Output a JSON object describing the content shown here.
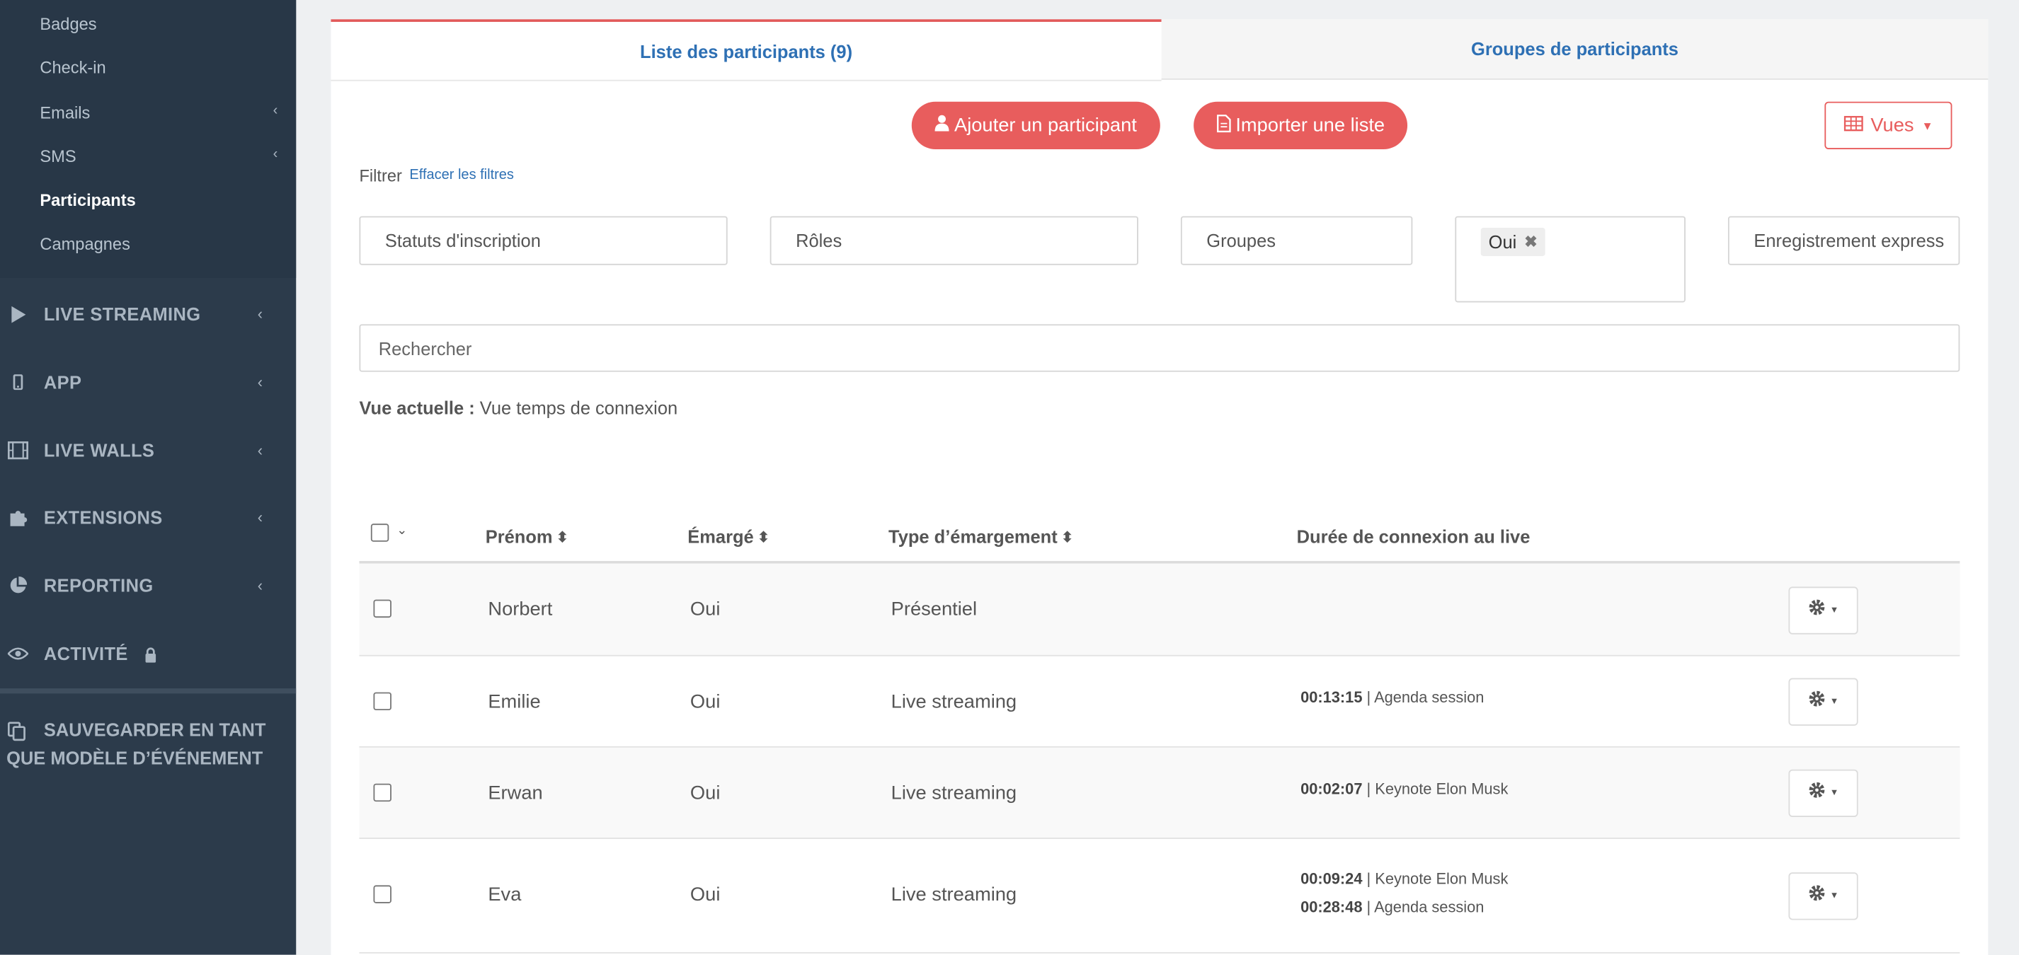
{
  "sidebar": {
    "sub_items": [
      {
        "label": "Badges",
        "chevron": false,
        "active": false
      },
      {
        "label": "Check-in",
        "chevron": false,
        "active": false
      },
      {
        "label": "Emails",
        "chevron": true,
        "active": false
      },
      {
        "label": "SMS",
        "chevron": true,
        "active": false
      },
      {
        "label": "Participants",
        "chevron": false,
        "active": true
      },
      {
        "label": "Campagnes",
        "chevron": false,
        "active": false
      }
    ],
    "nav": [
      {
        "label": "LIVE STREAMING",
        "icon": "play-icon"
      },
      {
        "label": "APP",
        "icon": "mobile-icon"
      },
      {
        "label": "LIVE WALLS",
        "icon": "film-icon"
      },
      {
        "label": "EXTENSIONS",
        "icon": "puzzle-icon"
      },
      {
        "label": "REPORTING",
        "icon": "pie-chart-icon"
      },
      {
        "label": "ACTIVITÉ",
        "icon": "eye-icon",
        "locked": true
      }
    ],
    "save_model_line1": "SAUVEGARDER EN TANT",
    "save_model_line2": "QUE MODÈLE D’ÉVÉNEMENT"
  },
  "tabs": {
    "participants": "Liste des participants (9)",
    "groups": "Groupes de participants"
  },
  "actions": {
    "add": "Ajouter un participant",
    "import": "Importer une liste",
    "views": "Vues"
  },
  "filters": {
    "label": "Filtrer",
    "clear": "Effacer les filtres",
    "status": "Statuts d'inscription",
    "roles": "Rôles",
    "groups": "Groupes",
    "tag": "Oui",
    "express": "Enregistrement express"
  },
  "search": {
    "placeholder": "Rechercher"
  },
  "current_view": {
    "label": "Vue actuelle :",
    "value": "Vue temps de connexion"
  },
  "table": {
    "headers": {
      "first_name": "Prénom",
      "signed": "Émargé",
      "sign_type": "Type d’émargement",
      "duration": "Durée de connexion au live"
    },
    "rows": [
      {
        "first_name": "Norbert",
        "signed": "Oui",
        "sign_type": "Présentiel",
        "durations": []
      },
      {
        "first_name": "Emilie",
        "signed": "Oui",
        "sign_type": "Live streaming",
        "durations": [
          {
            "time": "00:13:15",
            "session": "Agenda session"
          }
        ]
      },
      {
        "first_name": "Erwan",
        "signed": "Oui",
        "sign_type": "Live streaming",
        "durations": [
          {
            "time": "00:02:07",
            "session": "Keynote Elon Musk"
          }
        ]
      },
      {
        "first_name": "Eva",
        "signed": "Oui",
        "sign_type": "Live streaming",
        "durations": [
          {
            "time": "00:09:24",
            "session": "Keynote Elon Musk"
          },
          {
            "time": "00:28:48",
            "session": "Agenda session"
          }
        ]
      }
    ]
  },
  "colors": {
    "accent": "#e85d5d",
    "link": "#2e70b4",
    "sidebar": "#2c3b4b"
  }
}
